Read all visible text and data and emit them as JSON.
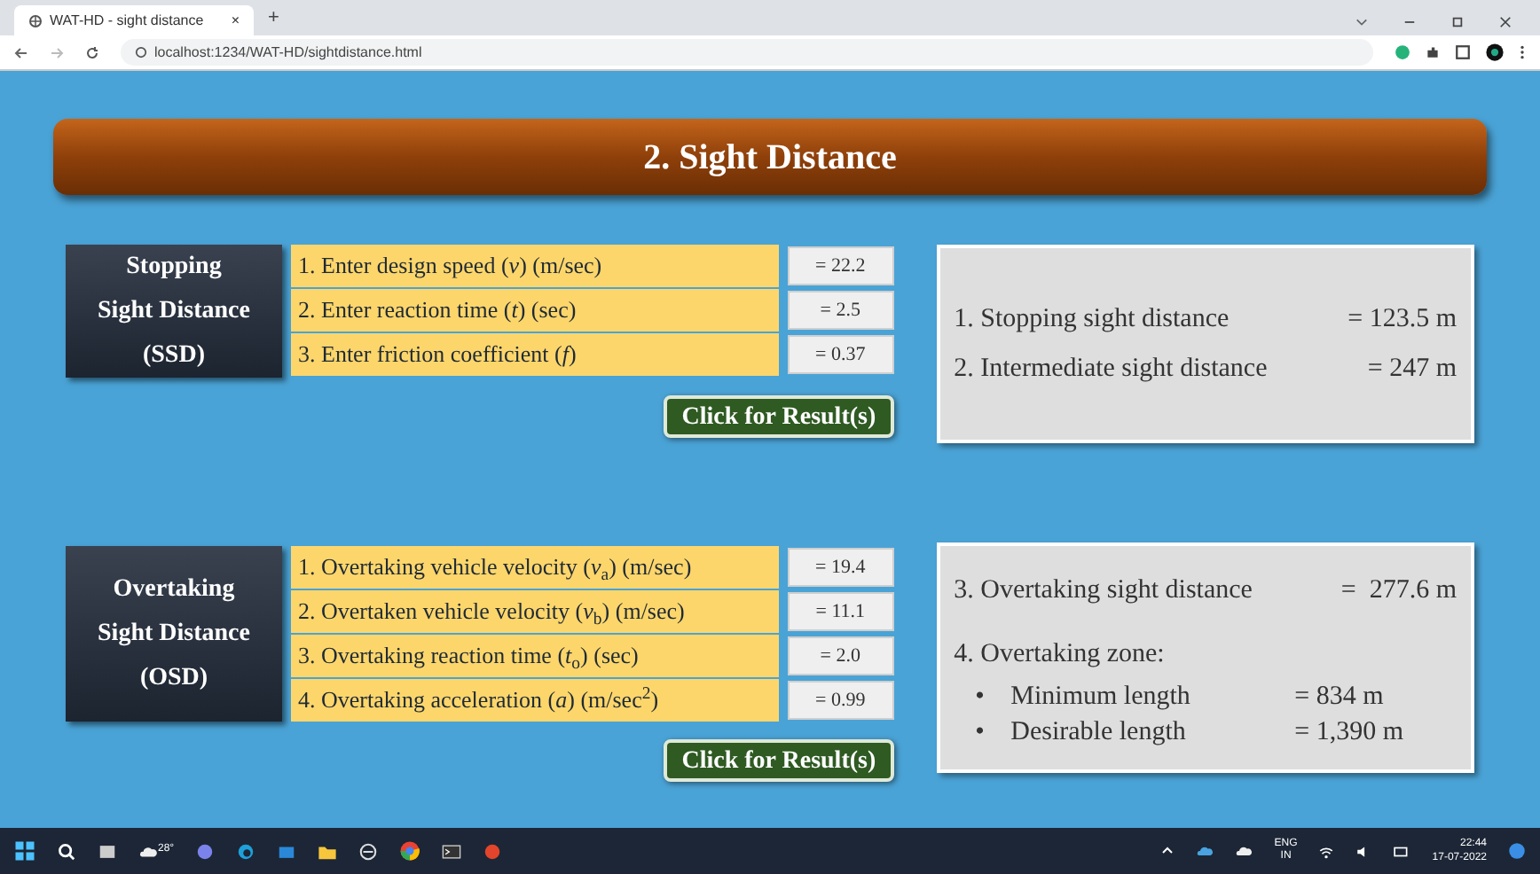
{
  "browser": {
    "tab": {
      "title": "WAT-HD - sight distance",
      "close": "×",
      "new_tab": "+"
    },
    "url": "localhost:1234/WAT-HD/sightdistance.html"
  },
  "page": {
    "title": "2. Sight Distance",
    "sections": [
      {
        "heading": [
          "Stopping",
          "Sight Distance",
          "(SSD)"
        ],
        "inputs": [
          {
            "label": "1. Enter design speed (*v*) (m/sec)",
            "value": "= 22.2"
          },
          {
            "label": "2. Enter reaction time (*t*) (sec)",
            "value": "= 2.5"
          },
          {
            "label": "3. Enter friction coefficient (*f*)",
            "value": "= 0.37"
          }
        ],
        "button": "Click for Result(s)",
        "results": [
          {
            "kind": "line",
            "label": "1. Stopping sight distance",
            "value": "= 123.5 m"
          },
          {
            "kind": "line",
            "label": "2. Intermediate sight distance",
            "value": "= 247 m"
          }
        ]
      },
      {
        "heading": [
          "Overtaking",
          "Sight Distance",
          "(OSD)"
        ],
        "inputs": [
          {
            "label": "1. Overtaking vehicle velocity (*v*$_{a}$) (m/sec)",
            "value": "= 19.4"
          },
          {
            "label": "2. Overtaken vehicle velocity (*v*$_{b}$) (m/sec)",
            "value": "= 11.1"
          },
          {
            "label": "3. Overtaking reaction time (*t*$_{o}$) (sec)",
            "value": "= 2.0"
          },
          {
            "label": "4. Overtaking acceleration (*a*) (m/sec$^{2}$)",
            "value": "= 0.99"
          }
        ],
        "button": "Click for Result(s)",
        "results": [
          {
            "kind": "line",
            "label": "3. Overtaking sight distance",
            "value": "=  277.6 m"
          },
          {
            "kind": "heading",
            "label": "4. Overtaking zone:"
          },
          {
            "kind": "bullet",
            "bullet": "•",
            "label": "Minimum length",
            "value": "= 834 m"
          },
          {
            "kind": "bullet",
            "bullet": "•",
            "label": "Desirable length",
            "value": "= 1,390 m"
          }
        ]
      }
    ]
  },
  "taskbar": {
    "weather": "28°",
    "language": [
      "ENG",
      "IN"
    ],
    "time": "22:44",
    "date": "17-07-2022"
  }
}
